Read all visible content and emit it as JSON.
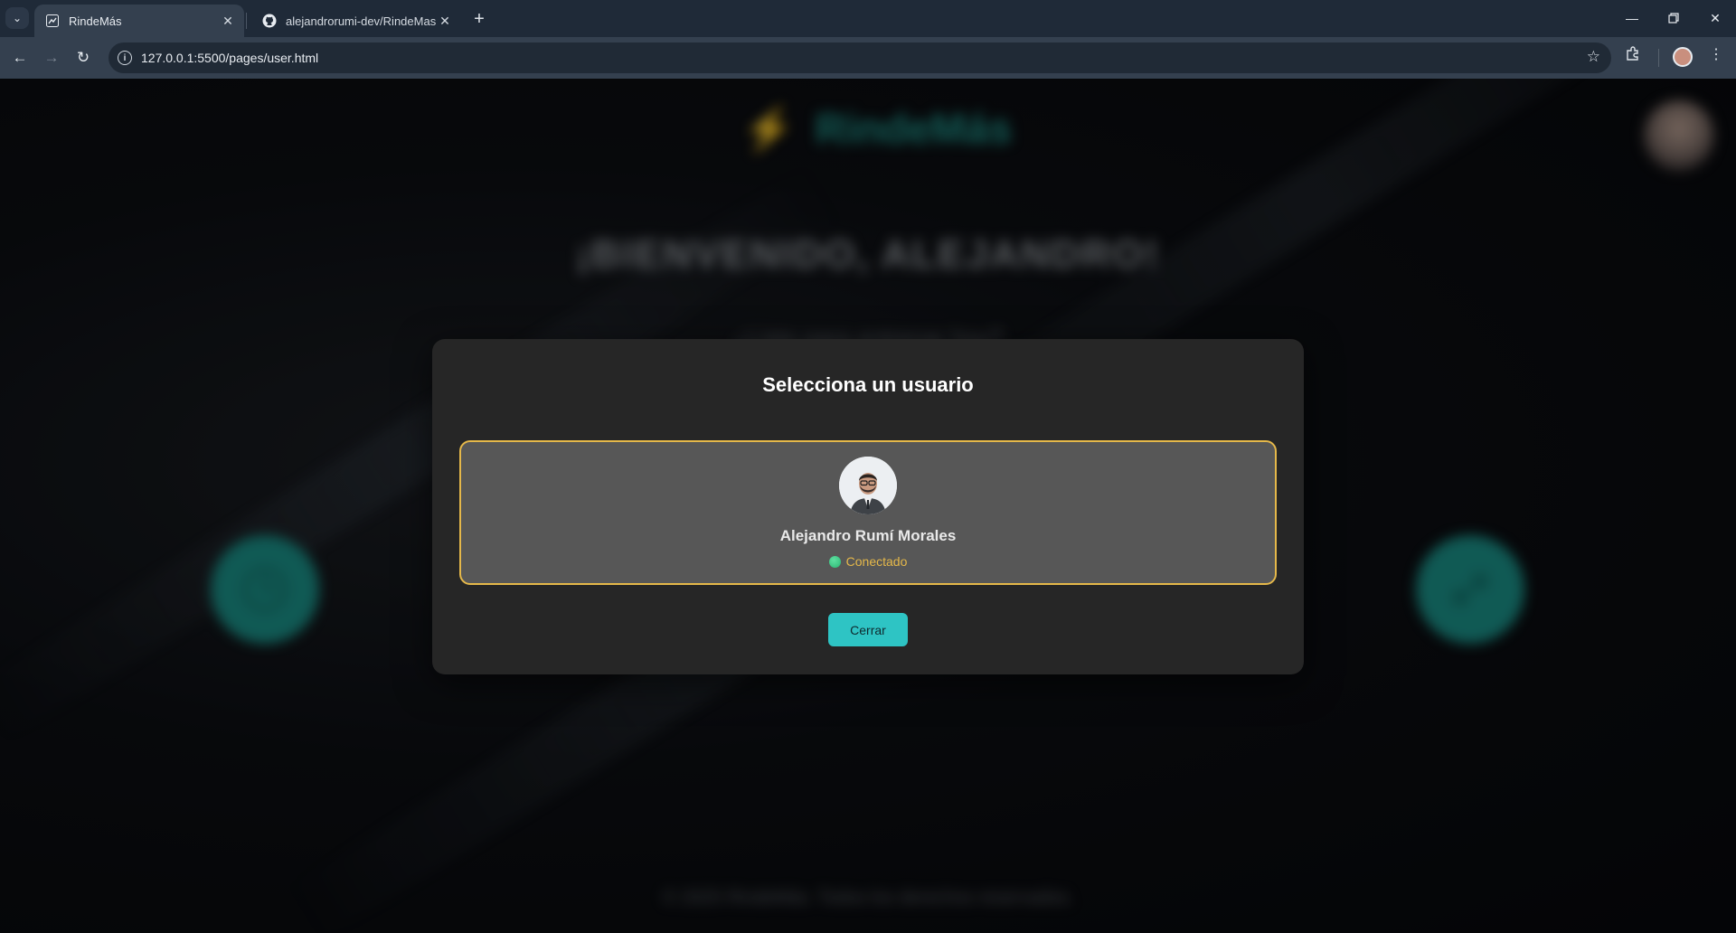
{
  "browser": {
    "tabs": [
      {
        "title": "RindeMás",
        "active": true
      },
      {
        "title": "alejandrorumi-dev/RindeMas: F",
        "active": false
      }
    ],
    "url": "127.0.0.1:5500/pages/user.html",
    "new_tab_label": "+",
    "close_glyph": "✕"
  },
  "page": {
    "brand": "RindeMás",
    "welcome": "¡BIENVENIDO, ALEJANDRO!",
    "subtitle": "¿Listo para entrenar hoy?",
    "footer": "© 2025 RindeMás. Todos los derechos reservados."
  },
  "modal": {
    "title": "Selecciona un usuario",
    "user": {
      "name": "Alejandro Rumí Morales",
      "status": "Conectado"
    },
    "close_label": "Cerrar"
  },
  "colors": {
    "accent": "#2ec4c4",
    "highlight": "#e5b84a",
    "status_online": "#2bb673",
    "modal_bg": "#262626"
  },
  "icons": [
    "tab-search-icon",
    "favicon-icon",
    "github-icon",
    "close-icon",
    "back-icon",
    "forward-icon",
    "reload-icon",
    "info-icon",
    "star-icon",
    "extensions-icon",
    "profile-icon",
    "menu-icon",
    "bolt-icon"
  ]
}
